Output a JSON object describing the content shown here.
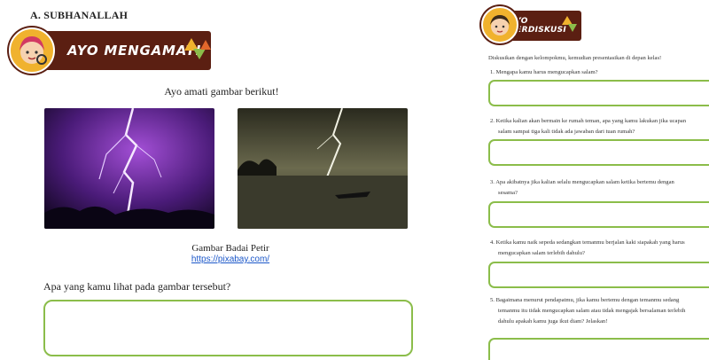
{
  "left": {
    "section_heading": "A. SUBHANALLAH",
    "banner_title": "AYO MENGAMATI",
    "intro": "Ayo amati gambar berikut!",
    "caption": "Gambar Badai Petir",
    "link": "https://pixabay.com/",
    "question": "Apa yang kamu lihat pada gambar tersebut?",
    "answer": ""
  },
  "right": {
    "banner_title": "AYO BERDISKUSI",
    "instruction": "Diskusikan dengan kelompokmu, kemudian presentasikan di depan kelas!",
    "questions": [
      {
        "line1": "1.  Mengapa kamu harus mengucapkan salam?",
        "line2": "",
        "answer": ""
      },
      {
        "line1": "2.  Ketika kalian akan bermain ke rumah teman, apa yang kamu lakukan jika ucapan",
        "line2": "salam sampai tiga kali tidak ada jawaban dari tuan rumah?",
        "answer": ""
      },
      {
        "line1": "3.  Apa akibatnya jika kalian selalu mengucapkan salam ketika bertemu dengan",
        "line2": "sesama?",
        "answer": ""
      },
      {
        "line1": "4.  Ketika kamu naik sepeda sedangkan temanmu berjalan kaki siapakah yang harus",
        "line2": "mengucapkan salam terlebih dahulu?",
        "answer": ""
      },
      {
        "line1": "5.  Bagaimana menurut pendapatmu, jika kamu bertemu dengan temanmu sedang",
        "line2": "temanmu itu tidak mengucapkan salam atau tidak mengajak bersalaman terlebih",
        "line3": "dahulu apakah kamu juga ikut diam? Jelaskan!",
        "answer": ""
      }
    ]
  },
  "colors": {
    "banner": "#5b1f12",
    "answer_border": "#8bbd4a",
    "link": "#1b57c9"
  },
  "icons": [
    "girl-avatar-icon",
    "boy-avatar-icon",
    "lightning-photo",
    "storm-boat-photo"
  ]
}
